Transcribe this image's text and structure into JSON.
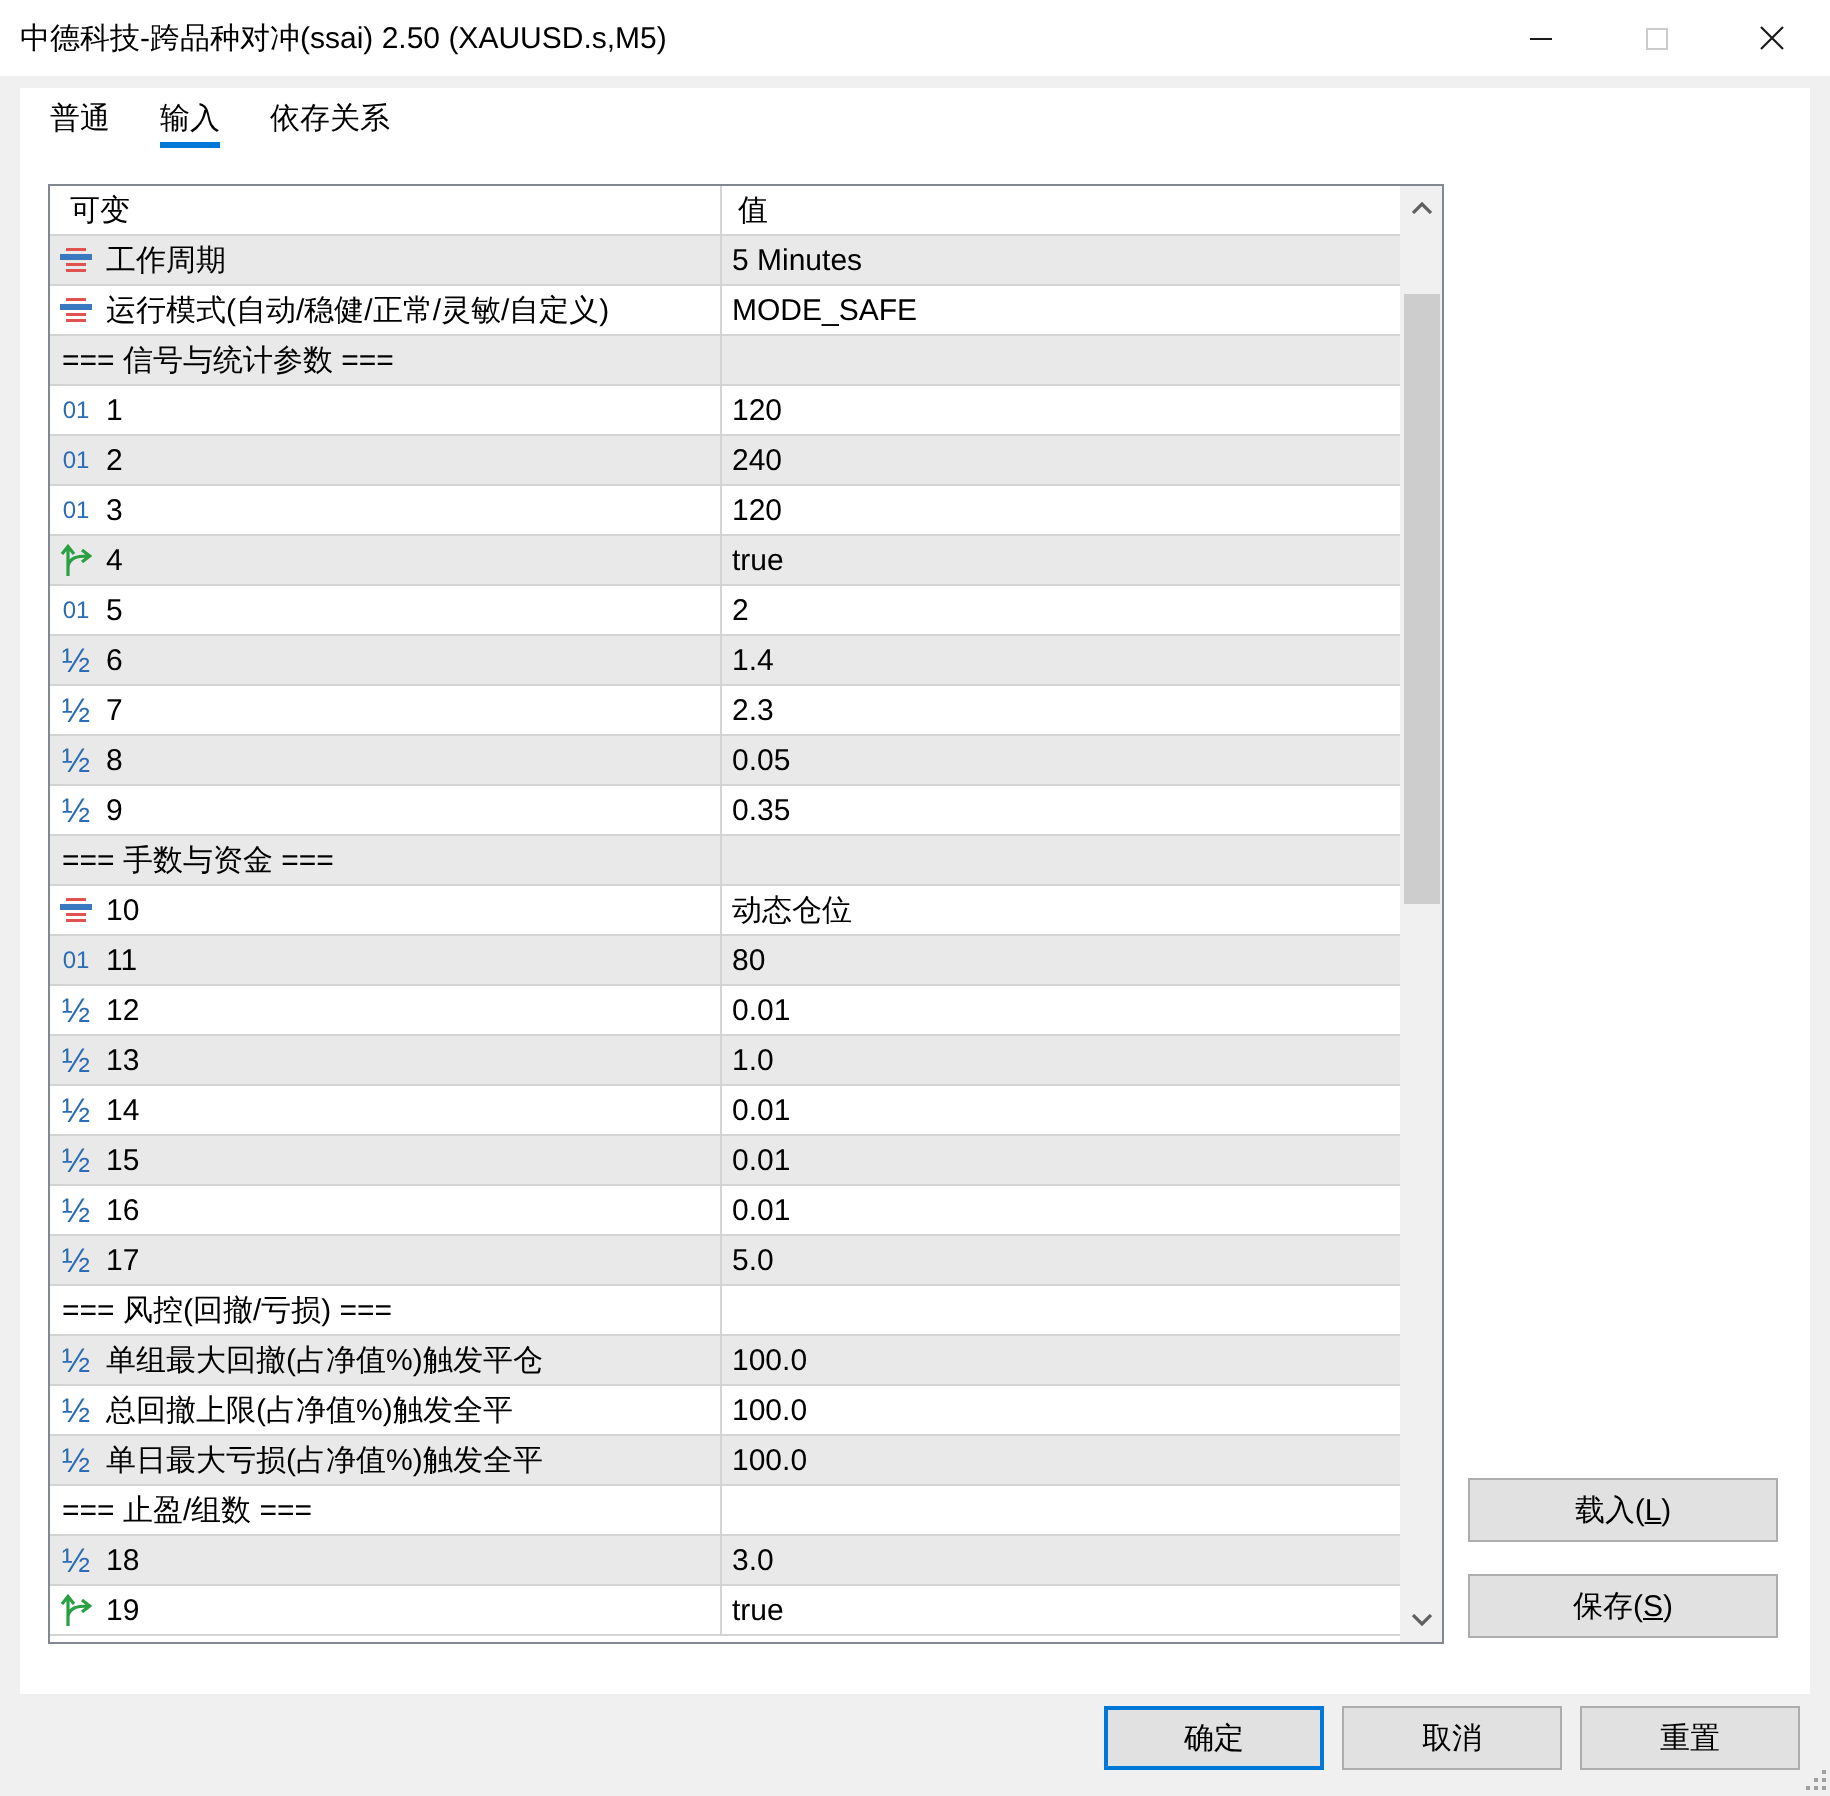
{
  "window": {
    "title": "中德科技-跨品种对冲(ssai) 2.50 (XAUUSD.s,M5)",
    "maximize_disabled": true
  },
  "tabs": [
    {
      "label": "普通",
      "selected": false
    },
    {
      "label": "输入",
      "selected": true
    },
    {
      "label": "依存关系",
      "selected": false
    }
  ],
  "table": {
    "columns": [
      "可变",
      "值"
    ],
    "rows": [
      {
        "kind": "enum",
        "name": "工作周期",
        "value": "5 Minutes"
      },
      {
        "kind": "enum",
        "name": "运行模式(自动/稳健/正常/灵敏/自定义)",
        "value": "MODE_SAFE"
      },
      {
        "kind": "section",
        "name": "=== 信号与统计参数 ==="
      },
      {
        "kind": "int",
        "glyph": "01",
        "name": "1",
        "value": "120"
      },
      {
        "kind": "int",
        "glyph": "01",
        "name": "2",
        "value": "240"
      },
      {
        "kind": "int",
        "glyph": "01",
        "name": "3",
        "value": "120"
      },
      {
        "kind": "bool",
        "name": "4",
        "value": "true"
      },
      {
        "kind": "int",
        "glyph": "01",
        "name": "5",
        "value": "2"
      },
      {
        "kind": "double",
        "glyph": "½",
        "name": "6",
        "value": "1.4"
      },
      {
        "kind": "double",
        "glyph": "½",
        "name": "7",
        "value": "2.3"
      },
      {
        "kind": "double",
        "glyph": "½",
        "name": "8",
        "value": "0.05"
      },
      {
        "kind": "double",
        "glyph": "½",
        "name": "9",
        "value": "0.35"
      },
      {
        "kind": "section",
        "name": "=== 手数与资金 ==="
      },
      {
        "kind": "enum",
        "name": "10",
        "value": "动态仓位"
      },
      {
        "kind": "int",
        "glyph": "01",
        "name": "11",
        "value": "80"
      },
      {
        "kind": "double",
        "glyph": "½",
        "name": "12",
        "value": "0.01"
      },
      {
        "kind": "double",
        "glyph": "½",
        "name": "13",
        "value": "1.0"
      },
      {
        "kind": "double",
        "glyph": "½",
        "name": "14",
        "value": "0.01"
      },
      {
        "kind": "double",
        "glyph": "½",
        "name": "15",
        "value": "0.01"
      },
      {
        "kind": "double",
        "glyph": "½",
        "name": "16",
        "value": "0.01"
      },
      {
        "kind": "double",
        "glyph": "½",
        "name": "17",
        "value": "5.0"
      },
      {
        "kind": "section",
        "name": "=== 风控(回撤/亏损) ==="
      },
      {
        "kind": "double",
        "glyph": "½",
        "name": "单组最大回撤(占净值%)触发平仓",
        "value": "100.0"
      },
      {
        "kind": "double",
        "glyph": "½",
        "name": "总回撤上限(占净值%)触发全平",
        "value": "100.0"
      },
      {
        "kind": "double",
        "glyph": "½",
        "name": "单日最大亏损(占净值%)触发全平",
        "value": "100.0"
      },
      {
        "kind": "section",
        "name": "=== 止盈/组数 ==="
      },
      {
        "kind": "double",
        "glyph": "½",
        "name": "18",
        "value": "3.0"
      },
      {
        "kind": "bool",
        "name": "19",
        "value": "true"
      }
    ]
  },
  "side_buttons": [
    {
      "label_start": "载入(",
      "access_key": "L",
      "label_end": ")"
    },
    {
      "label_start": "保存(",
      "access_key": "S",
      "label_end": ")"
    }
  ],
  "buttons": [
    {
      "label": "确定",
      "default": true
    },
    {
      "label": "取消",
      "default": false
    },
    {
      "label": "重置",
      "default": false
    }
  ]
}
